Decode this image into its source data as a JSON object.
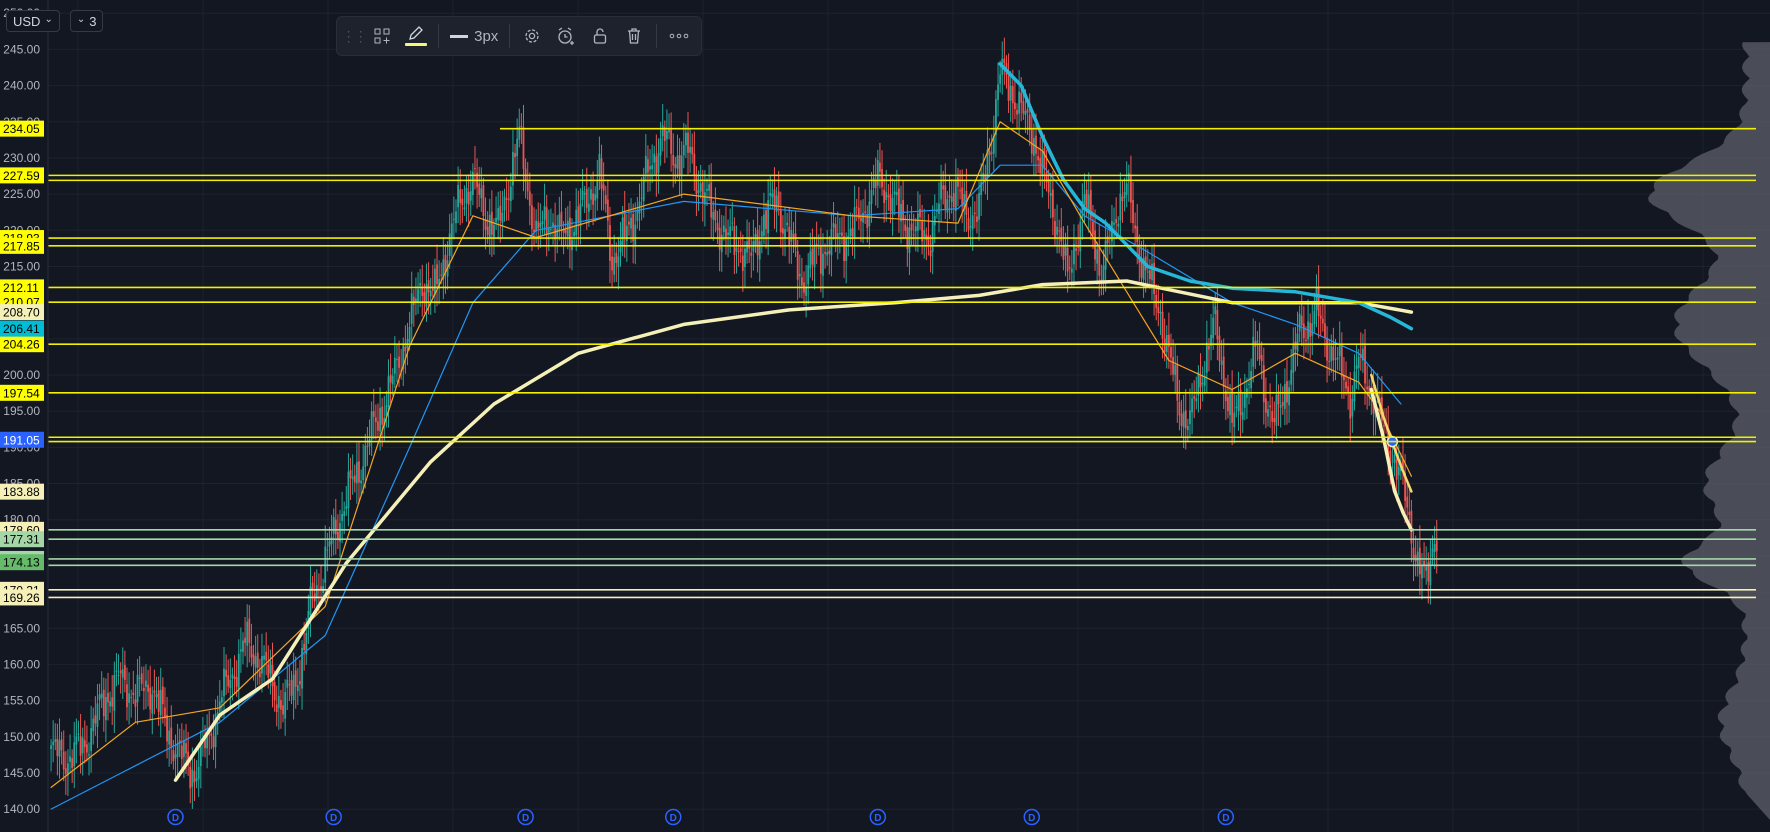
{
  "top_controls": {
    "currency": "USD",
    "currency_caret": "⌄",
    "collapse_caret": "⌄",
    "collapse_count": "3"
  },
  "toolbar": {
    "grip_icon": "drag-grip-icon",
    "layout_icon": "grid-add-icon",
    "pencil_icon": "pencil-icon",
    "line_width_label": "3px",
    "settings_icon": "gear-icon",
    "alert_icon": "alarm-clock-plus-icon",
    "lock_icon": "lock-open-icon",
    "delete_icon": "trash-icon",
    "more_icon": "more-dots-icon",
    "pencil_color": "#f5f57a"
  },
  "chart_data": {
    "type": "candlestick",
    "currency": "USD",
    "ylim": [
      138.5,
      251
    ],
    "y_ticks": [
      "250.00",
      "245.00",
      "240.00",
      "235.00",
      "230.00",
      "225.00",
      "220.00",
      "215.00",
      "210.00",
      "205.00",
      "200.00",
      "195.00",
      "190.00",
      "185.00",
      "180.00",
      "175.00",
      "170.00",
      "165.00",
      "160.00",
      "155.00",
      "150.00",
      "145.00",
      "140.00"
    ],
    "price_levels": [
      {
        "value": 234.05,
        "label": "234.05",
        "bg": "#ffff00",
        "fg": "#000000",
        "line": "#f0f000"
      },
      {
        "value": 227.59,
        "label": "227.59",
        "bg": "#ffff00",
        "fg": "#000000",
        "line": "#f0f000"
      },
      {
        "value": 226.9,
        "label": "",
        "bg": "",
        "fg": "",
        "line": "#f0f000"
      },
      {
        "value": 218.93,
        "label": "218.93",
        "bg": "#ffff00",
        "fg": "#000000",
        "line": "#f0f000"
      },
      {
        "value": 217.85,
        "label": "217.85",
        "bg": "#ffff00",
        "fg": "#000000",
        "line": "#f0f000"
      },
      {
        "value": 212.11,
        "label": "212.11",
        "bg": "#ffff00",
        "fg": "#000000",
        "line": "#f0f000"
      },
      {
        "value": 210.07,
        "label": "210.07",
        "bg": "#ffff00",
        "fg": "#000000",
        "line": "#f0f000"
      },
      {
        "value": 204.26,
        "label": "204.26",
        "bg": "#ffff00",
        "fg": "#000000",
        "line": "#f0f000"
      },
      {
        "value": 197.54,
        "label": "197.54",
        "bg": "#ffff00",
        "fg": "#000000",
        "line": "#f0f000"
      },
      {
        "value": 191.4,
        "label": "",
        "bg": "",
        "fg": "",
        "line": "#f0f000"
      },
      {
        "value": 190.8,
        "label": "",
        "bg": "",
        "fg": "",
        "line": "#f0f000"
      },
      {
        "value": 178.6,
        "label": "178.60",
        "bg": "#f5f0b8",
        "fg": "#000000",
        "line": "#a5d6a7"
      },
      {
        "value": 177.31,
        "label": "177.31",
        "bg": "#a5d6a7",
        "fg": "#000000",
        "line": "#a5d6a7"
      },
      {
        "value": 174.58,
        "label": "174.58",
        "bg": "#a5d6a7",
        "fg": "#000000",
        "line": "#a5d6a7"
      },
      {
        "value": 173.7,
        "label": "",
        "bg": "",
        "fg": "",
        "line": "#a5d6a7"
      },
      {
        "value": 170.31,
        "label": "170.31",
        "bg": "#f5f0b8",
        "fg": "#000000",
        "line": "#f5f0b8"
      },
      {
        "value": 169.26,
        "label": "169.26",
        "bg": "#f5f0b8",
        "fg": "#000000",
        "line": "#f5f0b8"
      }
    ],
    "value_badges": [
      {
        "value": 208.7,
        "label": "208.70",
        "bg": "#f5f0b8",
        "fg": "#000000"
      },
      {
        "value": 206.41,
        "label": "206.41",
        "bg": "#00bcd4",
        "fg": "#000000"
      },
      {
        "value": 191.05,
        "label": "191.05",
        "bg": "#2962ff",
        "fg": "#ffffff"
      },
      {
        "value": 183.88,
        "label": "183.88",
        "bg": "#f5f0b8",
        "fg": "#000000"
      },
      {
        "value": 174.13,
        "label": "174.13",
        "bg": "#66bb6a",
        "fg": "#000000"
      }
    ],
    "series_anchors": {
      "close": [
        [
          0,
          148
        ],
        [
          8,
          147
        ],
        [
          16,
          149
        ],
        [
          25,
          155
        ],
        [
          32,
          158
        ],
        [
          40,
          156
        ],
        [
          48,
          157
        ],
        [
          55,
          151
        ],
        [
          60,
          148
        ],
        [
          68,
          145
        ],
        [
          75,
          150
        ],
        [
          80,
          155
        ],
        [
          85,
          158
        ],
        [
          92,
          163
        ],
        [
          98,
          161
        ],
        [
          104,
          158
        ],
        [
          110,
          154
        ],
        [
          116,
          158
        ],
        [
          120,
          162
        ],
        [
          124,
          170
        ],
        [
          128,
          172
        ],
        [
          134,
          178
        ],
        [
          140,
          183
        ],
        [
          146,
          187
        ],
        [
          152,
          192
        ],
        [
          158,
          196
        ],
        [
          164,
          201
        ],
        [
          170,
          207
        ],
        [
          176,
          213
        ],
        [
          182,
          211
        ],
        [
          188,
          218
        ],
        [
          194,
          224
        ],
        [
          200,
          227
        ],
        [
          206,
          222
        ],
        [
          212,
          220
        ],
        [
          218,
          228
        ],
        [
          222,
          233
        ],
        [
          226,
          226
        ],
        [
          230,
          219
        ],
        [
          236,
          222
        ],
        [
          242,
          219
        ],
        [
          248,
          221
        ],
        [
          254,
          224
        ],
        [
          260,
          228
        ],
        [
          266,
          216
        ],
        [
          272,
          219
        ],
        [
          278,
          223
        ],
        [
          284,
          229
        ],
        [
          290,
          233
        ],
        [
          296,
          230
        ],
        [
          302,
          231
        ],
        [
          308,
          226
        ],
        [
          314,
          222
        ],
        [
          320,
          219
        ],
        [
          326,
          218
        ],
        [
          332,
          216
        ],
        [
          338,
          222
        ],
        [
          344,
          224
        ],
        [
          350,
          219
        ],
        [
          356,
          213
        ],
        [
          362,
          216
        ],
        [
          368,
          218
        ],
        [
          374,
          219
        ],
        [
          380,
          220
        ],
        [
          386,
          223
        ],
        [
          392,
          227
        ],
        [
          398,
          225
        ],
        [
          404,
          221
        ],
        [
          410,
          220
        ],
        [
          416,
          219
        ],
        [
          422,
          224
        ],
        [
          428,
          226
        ],
        [
          434,
          222
        ],
        [
          440,
          223
        ],
        [
          446,
          233
        ],
        [
          450,
          242
        ],
        [
          454,
          240
        ],
        [
          458,
          238
        ],
        [
          462,
          235
        ],
        [
          466,
          233
        ],
        [
          470,
          228
        ],
        [
          474,
          224
        ],
        [
          478,
          220
        ],
        [
          482,
          213
        ],
        [
          486,
          219
        ],
        [
          490,
          224
        ],
        [
          494,
          220
        ],
        [
          498,
          214
        ],
        [
          502,
          218
        ],
        [
          506,
          224
        ],
        [
          510,
          226
        ],
        [
          514,
          220
        ],
        [
          518,
          215
        ],
        [
          522,
          212
        ],
        [
          526,
          209
        ],
        [
          528,
          205
        ],
        [
          532,
          200
        ],
        [
          536,
          195
        ],
        [
          540,
          193
        ],
        [
          544,
          199
        ],
        [
          548,
          203
        ],
        [
          552,
          207
        ],
        [
          556,
          200
        ],
        [
          560,
          193
        ],
        [
          564,
          196
        ],
        [
          568,
          200
        ],
        [
          572,
          204
        ],
        [
          576,
          197
        ],
        [
          580,
          193
        ],
        [
          584,
          197
        ],
        [
          588,
          201
        ],
        [
          592,
          206
        ],
        [
          596,
          207
        ],
        [
          600,
          209
        ],
        [
          604,
          205
        ],
        [
          608,
          203
        ],
        [
          612,
          200
        ],
        [
          616,
          197
        ],
        [
          620,
          202
        ],
        [
          624,
          199
        ],
        [
          628,
          197
        ],
        [
          632,
          192
        ],
        [
          636,
          189
        ],
        [
          640,
          186
        ],
        [
          644,
          180
        ],
        [
          648,
          174
        ],
        [
          652,
          171
        ],
        [
          654,
          175
        ],
        [
          656,
          178
        ]
      ],
      "wick_spread": 2.2
    },
    "indicators": [
      {
        "name": "",
        "color": "#2196f3",
        "width": 1.2,
        "points": [
          [
            0,
            140
          ],
          [
            40,
            146
          ],
          [
            80,
            152
          ],
          [
            130,
            164
          ],
          [
            170,
            190
          ],
          [
            200,
            210
          ],
          [
            230,
            220
          ],
          [
            300,
            224
          ],
          [
            380,
            222
          ],
          [
            430,
            223
          ],
          [
            450,
            229
          ],
          [
            470,
            229
          ],
          [
            490,
            222
          ],
          [
            520,
            217
          ],
          [
            560,
            210
          ],
          [
            590,
            207
          ],
          [
            620,
            203
          ],
          [
            640,
            196
          ]
        ]
      },
      {
        "name": "",
        "color": "#f5a623",
        "width": 1.2,
        "points": [
          [
            0,
            143
          ],
          [
            40,
            152
          ],
          [
            80,
            154
          ],
          [
            130,
            168
          ],
          [
            170,
            204
          ],
          [
            200,
            222
          ],
          [
            230,
            219
          ],
          [
            300,
            225
          ],
          [
            380,
            222
          ],
          [
            430,
            221
          ],
          [
            450,
            235
          ],
          [
            470,
            231
          ],
          [
            490,
            221
          ],
          [
            530,
            202
          ],
          [
            560,
            198
          ],
          [
            590,
            203
          ],
          [
            620,
            199
          ],
          [
            630,
            195
          ],
          [
            645,
            186
          ]
        ]
      },
      {
        "name": "",
        "color": "#f5f0b8",
        "width": 3.5,
        "points": [
          [
            59,
            144
          ],
          [
            80,
            153
          ],
          [
            105,
            158
          ],
          [
            140,
            174
          ],
          [
            180,
            188
          ],
          [
            210,
            196
          ],
          [
            250,
            203
          ],
          [
            300,
            207
          ],
          [
            350,
            209
          ],
          [
            400,
            210
          ],
          [
            440,
            211
          ],
          [
            470,
            212.5
          ],
          [
            510,
            213
          ],
          [
            560,
            210
          ],
          [
            600,
            210
          ],
          [
            620,
            210
          ],
          [
            645,
            208.7
          ]
        ]
      },
      {
        "name": "",
        "color": "#26b7d8",
        "width": 3.5,
        "points": [
          [
            450,
            243
          ],
          [
            460,
            240
          ],
          [
            470,
            233
          ],
          [
            480,
            227
          ],
          [
            490,
            223
          ],
          [
            500,
            221
          ],
          [
            510,
            218
          ],
          [
            520,
            215
          ],
          [
            540,
            213
          ],
          [
            560,
            212
          ],
          [
            590,
            211.5
          ],
          [
            620,
            210
          ],
          [
            635,
            208
          ],
          [
            645,
            206.4
          ]
        ]
      },
      {
        "name": "",
        "color": "#f5f0b8",
        "width": 3.5,
        "points": [
          [
            626,
            198
          ],
          [
            632,
            191
          ],
          [
            637,
            184
          ],
          [
            641,
            181
          ],
          [
            645,
            178.6
          ]
        ]
      },
      {
        "name": "",
        "color": "#f5d76e",
        "width": 2.5,
        "points": [
          [
            626,
            200
          ],
          [
            632,
            194
          ],
          [
            638,
            189
          ],
          [
            642,
            186
          ],
          [
            645,
            183.9
          ]
        ]
      }
    ],
    "event_markers": [
      {
        "label": "D",
        "bar": 59
      },
      {
        "label": "D",
        "bar": 134
      },
      {
        "label": "D",
        "bar": 225
      },
      {
        "label": "D",
        "bar": 295
      },
      {
        "label": "D",
        "bar": 392
      },
      {
        "label": "D",
        "bar": 465
      },
      {
        "label": "D",
        "bar": 557
      }
    ],
    "volume_profile_color": "#5d606b",
    "colors": {
      "up": "#26a69a",
      "down": "#ef5350",
      "background": "#131722",
      "grid": "#1e222d",
      "axis_text": "#b2b5be"
    },
    "legend": "none",
    "grid": true
  }
}
